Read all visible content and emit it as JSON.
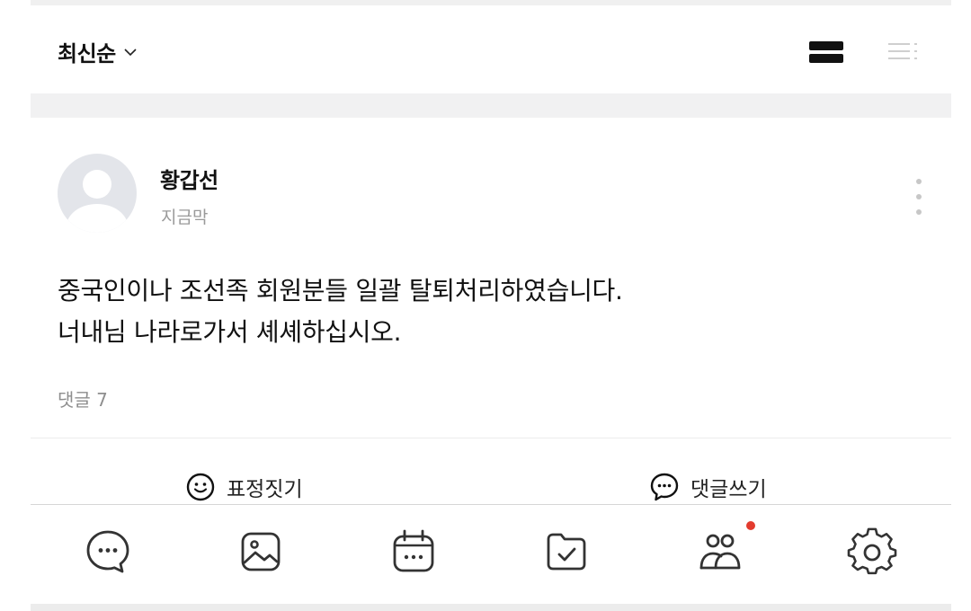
{
  "sort": {
    "label": "최신순"
  },
  "view_toggle": {
    "active": "card"
  },
  "post": {
    "author": "황갑선",
    "time": "지금막",
    "content_lines": [
      "중국인이나 조선족 회원분들 일괄 탈퇴처리하였습니다.",
      "너내님 나라로가서 셰셰하십시오."
    ],
    "comment_count": "댓글 7",
    "actions": {
      "emoji_label": "표정짓기",
      "comment_label": "댓글쓰기"
    }
  },
  "tabbar": {
    "items": [
      {
        "icon": "chat-bubble-icon"
      },
      {
        "icon": "photo-icon"
      },
      {
        "icon": "calendar-icon"
      },
      {
        "icon": "folder-check-icon"
      },
      {
        "icon": "members-icon",
        "badge": true
      },
      {
        "icon": "gear-icon"
      }
    ]
  },
  "colors": {
    "badge": "#e33b2e",
    "muted_text": "#9a9a9a",
    "band": "#f1f1f2"
  }
}
